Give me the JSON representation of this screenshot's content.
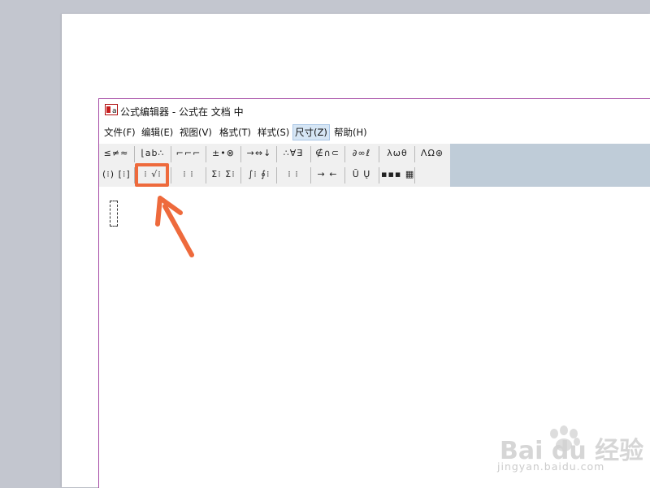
{
  "window": {
    "title": "公式编辑器 - 公式在 文档 中",
    "icon": "equation-editor-icon"
  },
  "menu": [
    {
      "label": "文件(F)"
    },
    {
      "label": "编辑(E)"
    },
    {
      "label": "视图(V)"
    },
    {
      "label": "格式(T)"
    },
    {
      "label": "样式(S)"
    },
    {
      "label": "尺寸(Z)"
    },
    {
      "label": "帮助(H)"
    }
  ],
  "toolbar": {
    "row1": [
      {
        "label": "≤≠≈"
      },
      {
        "label": "⌊ab∴"
      },
      {
        "label": "⌐⌐⌐"
      },
      {
        "label": "±•⊗"
      },
      {
        "label": "→⇔↓"
      },
      {
        "label": "∴∀∃"
      },
      {
        "label": "∉∩⊂"
      },
      {
        "label": "∂∞ℓ"
      },
      {
        "label": "λωθ"
      },
      {
        "label": "ΛΩ⊛"
      }
    ],
    "row2": [
      {
        "label": "(⁝) [⁝]"
      },
      {
        "label": "⁝ √⁝"
      },
      {
        "label": "⁝ ⁝"
      },
      {
        "label": "Σ⁝ Σ⁝"
      },
      {
        "label": "∫⁝ ∮⁝"
      },
      {
        "label": "⁝ ⁝"
      },
      {
        "label": "→ ←"
      },
      {
        "label": "Ū Ų"
      },
      {
        "label": "▪▪▪ ▦"
      }
    ]
  },
  "accent_color": "#ee6a3c",
  "watermark": {
    "brand": "Bai du 经验",
    "url": "jingyan.baidu.com"
  }
}
